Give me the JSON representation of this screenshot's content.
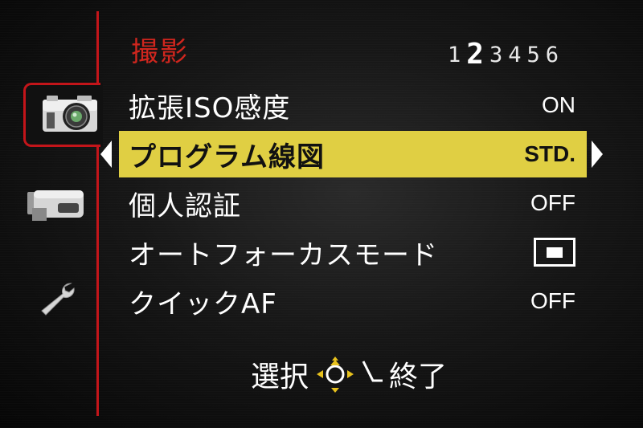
{
  "title": "撮影",
  "tabs": [
    {
      "icon": "camera-icon",
      "active": true
    },
    {
      "icon": "video-camera-icon",
      "active": false
    },
    {
      "icon": "wrench-icon",
      "active": false
    }
  ],
  "pages": [
    "1",
    "2",
    "3",
    "4",
    "5",
    "6"
  ],
  "current_page": "2",
  "rows": [
    {
      "label": "拡張ISO感度",
      "value": "ON"
    },
    {
      "label": "プログラム線図",
      "value": "STD."
    },
    {
      "label": "個人認証",
      "value": "OFF"
    },
    {
      "label": "オートフォーカスモード",
      "value": "",
      "value_icon": "single-area-focus-icon"
    },
    {
      "label": "クイックAF",
      "value": "OFF"
    }
  ],
  "selected_index": 1,
  "footer": {
    "select_label": "選択",
    "exit_label": "終了",
    "dpad_icon": "dpad-icon",
    "return_icon": "return-arrow-icon"
  },
  "colors": {
    "accent": "#c3151a",
    "title": "#d0261e",
    "highlight": "#e0cf43",
    "dpad": "#e8c21d"
  }
}
